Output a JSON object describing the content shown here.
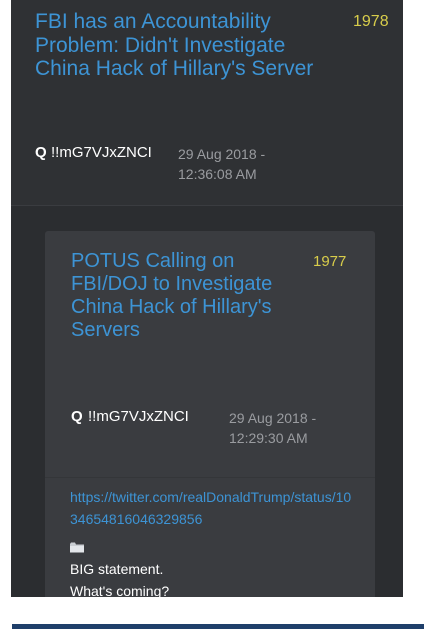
{
  "post": {
    "title": "FBI has an Accountability Problem: Didn't Investigate China Hack of Hillary's Server",
    "number": "1978",
    "author": "Q",
    "tripcode": "!!mG7VJxZNCI",
    "date": "29 Aug 2018 -",
    "time": "12:36:08 AM"
  },
  "quoted": {
    "title": "POTUS Calling on FBI/DOJ to Investigate China Hack of Hillary's Servers",
    "number": "1977",
    "author": "Q",
    "tripcode": "!!mG7VJxZNCI",
    "date": "29 Aug 2018 -",
    "time": "12:29:30 AM",
    "link": "https://twitter.com/realDonaldTrump/status/1034654816046329856",
    "icon": "folder-icon",
    "line1": "BIG statement.",
    "line2": "What's coming?"
  },
  "colors": {
    "link": "#3d94d5",
    "number": "#d8cd4b",
    "background": "#2b2d30",
    "quote_bg": "#3a3c40"
  }
}
